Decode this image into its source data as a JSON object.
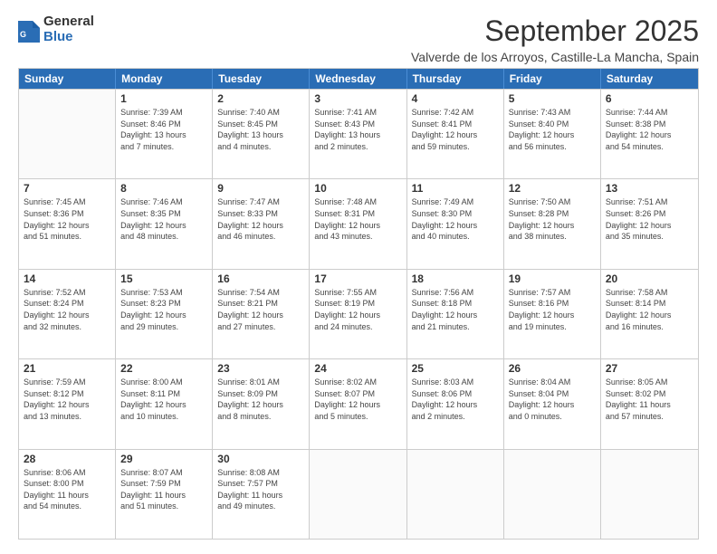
{
  "logo": {
    "general": "General",
    "blue": "Blue"
  },
  "title": "September 2025",
  "subtitle": "Valverde de los Arroyos, Castille-La Mancha, Spain",
  "days_of_week": [
    "Sunday",
    "Monday",
    "Tuesday",
    "Wednesday",
    "Thursday",
    "Friday",
    "Saturday"
  ],
  "weeks": [
    [
      {
        "day": "",
        "lines": []
      },
      {
        "day": "1",
        "lines": [
          "Sunrise: 7:39 AM",
          "Sunset: 8:46 PM",
          "Daylight: 13 hours",
          "and 7 minutes."
        ]
      },
      {
        "day": "2",
        "lines": [
          "Sunrise: 7:40 AM",
          "Sunset: 8:45 PM",
          "Daylight: 13 hours",
          "and 4 minutes."
        ]
      },
      {
        "day": "3",
        "lines": [
          "Sunrise: 7:41 AM",
          "Sunset: 8:43 PM",
          "Daylight: 13 hours",
          "and 2 minutes."
        ]
      },
      {
        "day": "4",
        "lines": [
          "Sunrise: 7:42 AM",
          "Sunset: 8:41 PM",
          "Daylight: 12 hours",
          "and 59 minutes."
        ]
      },
      {
        "day": "5",
        "lines": [
          "Sunrise: 7:43 AM",
          "Sunset: 8:40 PM",
          "Daylight: 12 hours",
          "and 56 minutes."
        ]
      },
      {
        "day": "6",
        "lines": [
          "Sunrise: 7:44 AM",
          "Sunset: 8:38 PM",
          "Daylight: 12 hours",
          "and 54 minutes."
        ]
      }
    ],
    [
      {
        "day": "7",
        "lines": [
          "Sunrise: 7:45 AM",
          "Sunset: 8:36 PM",
          "Daylight: 12 hours",
          "and 51 minutes."
        ]
      },
      {
        "day": "8",
        "lines": [
          "Sunrise: 7:46 AM",
          "Sunset: 8:35 PM",
          "Daylight: 12 hours",
          "and 48 minutes."
        ]
      },
      {
        "day": "9",
        "lines": [
          "Sunrise: 7:47 AM",
          "Sunset: 8:33 PM",
          "Daylight: 12 hours",
          "and 46 minutes."
        ]
      },
      {
        "day": "10",
        "lines": [
          "Sunrise: 7:48 AM",
          "Sunset: 8:31 PM",
          "Daylight: 12 hours",
          "and 43 minutes."
        ]
      },
      {
        "day": "11",
        "lines": [
          "Sunrise: 7:49 AM",
          "Sunset: 8:30 PM",
          "Daylight: 12 hours",
          "and 40 minutes."
        ]
      },
      {
        "day": "12",
        "lines": [
          "Sunrise: 7:50 AM",
          "Sunset: 8:28 PM",
          "Daylight: 12 hours",
          "and 38 minutes."
        ]
      },
      {
        "day": "13",
        "lines": [
          "Sunrise: 7:51 AM",
          "Sunset: 8:26 PM",
          "Daylight: 12 hours",
          "and 35 minutes."
        ]
      }
    ],
    [
      {
        "day": "14",
        "lines": [
          "Sunrise: 7:52 AM",
          "Sunset: 8:24 PM",
          "Daylight: 12 hours",
          "and 32 minutes."
        ]
      },
      {
        "day": "15",
        "lines": [
          "Sunrise: 7:53 AM",
          "Sunset: 8:23 PM",
          "Daylight: 12 hours",
          "and 29 minutes."
        ]
      },
      {
        "day": "16",
        "lines": [
          "Sunrise: 7:54 AM",
          "Sunset: 8:21 PM",
          "Daylight: 12 hours",
          "and 27 minutes."
        ]
      },
      {
        "day": "17",
        "lines": [
          "Sunrise: 7:55 AM",
          "Sunset: 8:19 PM",
          "Daylight: 12 hours",
          "and 24 minutes."
        ]
      },
      {
        "day": "18",
        "lines": [
          "Sunrise: 7:56 AM",
          "Sunset: 8:18 PM",
          "Daylight: 12 hours",
          "and 21 minutes."
        ]
      },
      {
        "day": "19",
        "lines": [
          "Sunrise: 7:57 AM",
          "Sunset: 8:16 PM",
          "Daylight: 12 hours",
          "and 19 minutes."
        ]
      },
      {
        "day": "20",
        "lines": [
          "Sunrise: 7:58 AM",
          "Sunset: 8:14 PM",
          "Daylight: 12 hours",
          "and 16 minutes."
        ]
      }
    ],
    [
      {
        "day": "21",
        "lines": [
          "Sunrise: 7:59 AM",
          "Sunset: 8:12 PM",
          "Daylight: 12 hours",
          "and 13 minutes."
        ]
      },
      {
        "day": "22",
        "lines": [
          "Sunrise: 8:00 AM",
          "Sunset: 8:11 PM",
          "Daylight: 12 hours",
          "and 10 minutes."
        ]
      },
      {
        "day": "23",
        "lines": [
          "Sunrise: 8:01 AM",
          "Sunset: 8:09 PM",
          "Daylight: 12 hours",
          "and 8 minutes."
        ]
      },
      {
        "day": "24",
        "lines": [
          "Sunrise: 8:02 AM",
          "Sunset: 8:07 PM",
          "Daylight: 12 hours",
          "and 5 minutes."
        ]
      },
      {
        "day": "25",
        "lines": [
          "Sunrise: 8:03 AM",
          "Sunset: 8:06 PM",
          "Daylight: 12 hours",
          "and 2 minutes."
        ]
      },
      {
        "day": "26",
        "lines": [
          "Sunrise: 8:04 AM",
          "Sunset: 8:04 PM",
          "Daylight: 12 hours",
          "and 0 minutes."
        ]
      },
      {
        "day": "27",
        "lines": [
          "Sunrise: 8:05 AM",
          "Sunset: 8:02 PM",
          "Daylight: 11 hours",
          "and 57 minutes."
        ]
      }
    ],
    [
      {
        "day": "28",
        "lines": [
          "Sunrise: 8:06 AM",
          "Sunset: 8:00 PM",
          "Daylight: 11 hours",
          "and 54 minutes."
        ]
      },
      {
        "day": "29",
        "lines": [
          "Sunrise: 8:07 AM",
          "Sunset: 7:59 PM",
          "Daylight: 11 hours",
          "and 51 minutes."
        ]
      },
      {
        "day": "30",
        "lines": [
          "Sunrise: 8:08 AM",
          "Sunset: 7:57 PM",
          "Daylight: 11 hours",
          "and 49 minutes."
        ]
      },
      {
        "day": "",
        "lines": []
      },
      {
        "day": "",
        "lines": []
      },
      {
        "day": "",
        "lines": []
      },
      {
        "day": "",
        "lines": []
      }
    ]
  ]
}
